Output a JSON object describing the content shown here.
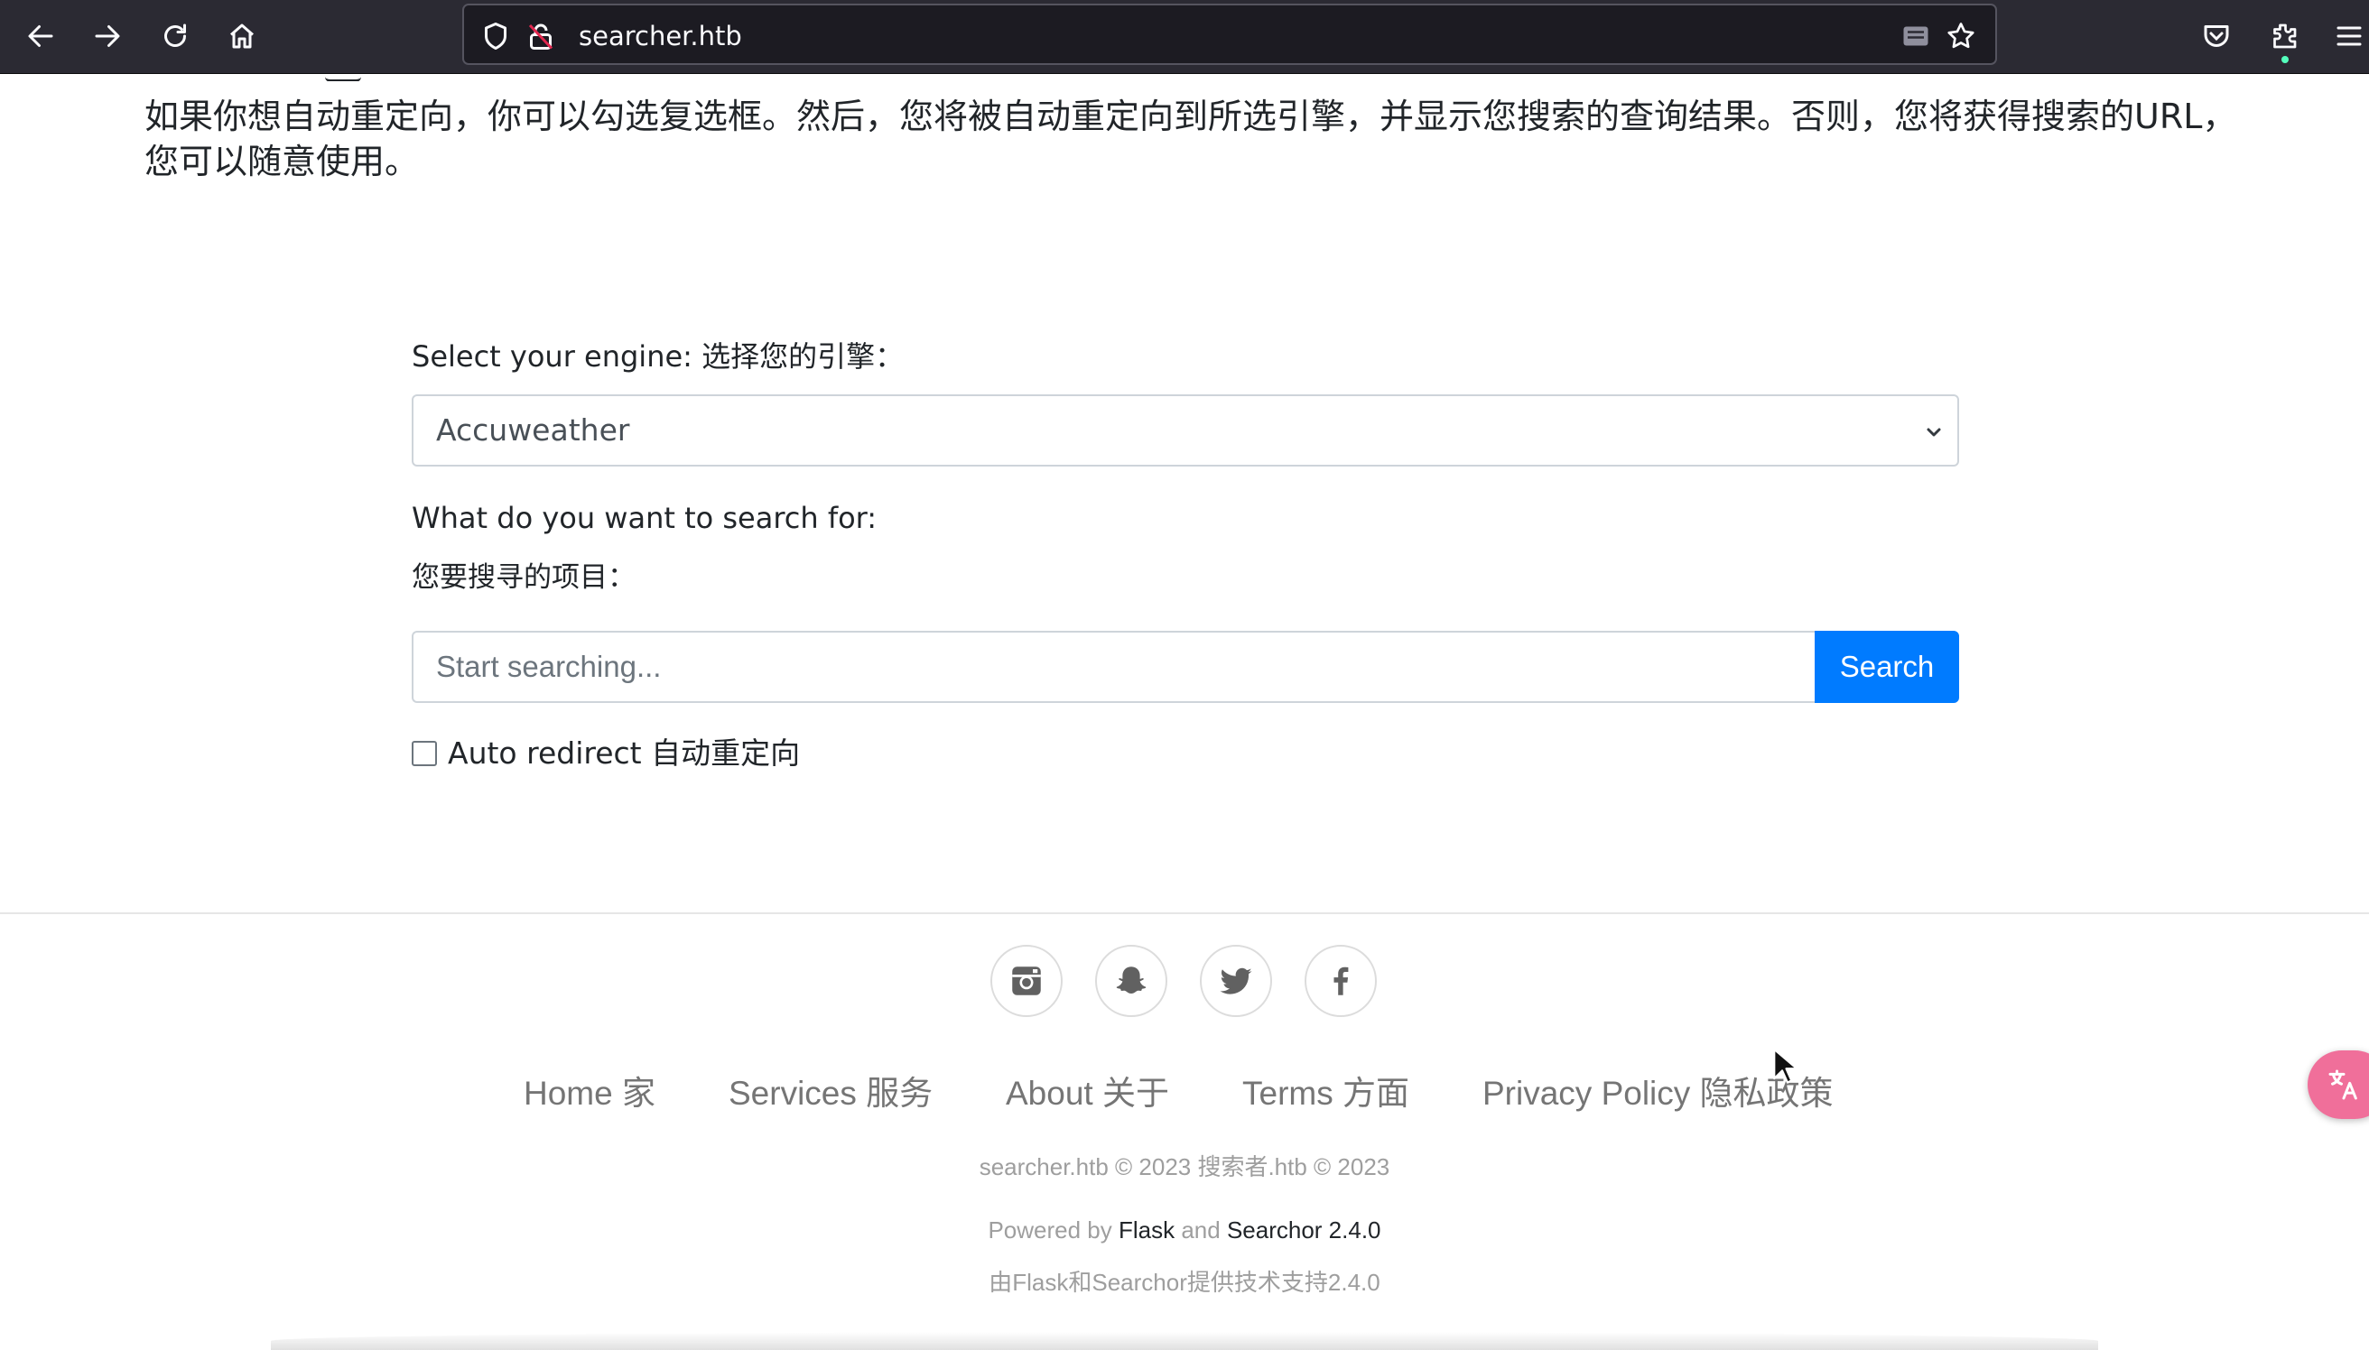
{
  "browser": {
    "url": "searcher.htb"
  },
  "intro": {
    "text": "如果你想自动重定向，你可以勾选复选框。然后，您将被自动重定向到所选引擎，并显示您搜索的查询结果。否则，您将获得搜索的URL，您可以随意使用。"
  },
  "form": {
    "engine_label": "Select your engine: 选择您的引擎：",
    "engine_selected": "Accuweather",
    "query_label_en": "What do you want to search for:",
    "query_label_zh": "您要搜寻的项目：",
    "search_placeholder": "Start searching...",
    "search_button": "Search",
    "auto_redirect_label": "Auto redirect 自动重定向"
  },
  "footer": {
    "links": [
      {
        "label": "Home  家"
      },
      {
        "label": "Services  服务"
      },
      {
        "label": "About  关于"
      },
      {
        "label": "Terms  方面"
      },
      {
        "label": "Privacy Policy  隐私政策"
      }
    ],
    "copyright": "searcher.htb © 2023 搜索者.htb © 2023",
    "powered_prefix": "Powered by ",
    "powered_flask": "Flask",
    "powered_and": " and ",
    "powered_searchor": "Searchor 2.4.0",
    "powered_zh": "由Flask和Searchor提供技术支持2.4.0",
    "social_icons": [
      "instagram-icon",
      "snapchat-icon",
      "twitter-icon",
      "facebook-icon"
    ]
  },
  "colors": {
    "primary": "#007bff",
    "chrome_bg": "#2b2a33",
    "footer_link": "#757575"
  }
}
